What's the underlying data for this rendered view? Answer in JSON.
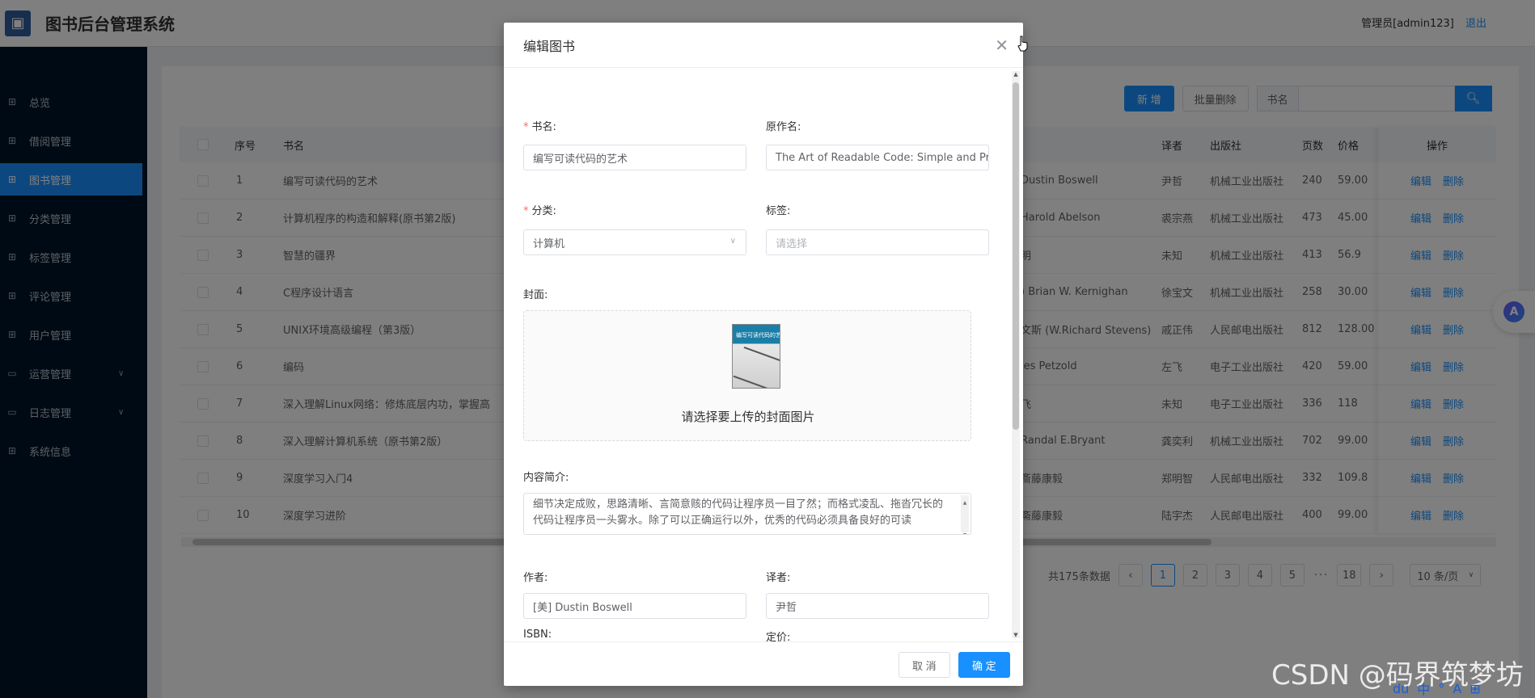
{
  "header": {
    "title": "图书后台管理系统",
    "user": "管理员[admin123]",
    "logout": "退出"
  },
  "sidebar": {
    "items": [
      {
        "label": "总览",
        "icon": "grid-icon"
      },
      {
        "label": "借阅管理",
        "icon": "grid-icon"
      },
      {
        "label": "图书管理",
        "icon": "grid-icon",
        "active": true
      },
      {
        "label": "分类管理",
        "icon": "grid-icon"
      },
      {
        "label": "标签管理",
        "icon": "grid-icon"
      },
      {
        "label": "评论管理",
        "icon": "grid-icon"
      },
      {
        "label": "用户管理",
        "icon": "grid-icon"
      },
      {
        "label": "运营管理",
        "icon": "folder-icon",
        "expandable": true
      },
      {
        "label": "日志管理",
        "icon": "folder-icon",
        "expandable": true
      },
      {
        "label": "系统信息",
        "icon": "grid-icon"
      }
    ]
  },
  "toolbar": {
    "add": "新 增",
    "batch_delete": "批量删除",
    "search_label": "书名"
  },
  "table": {
    "headers": {
      "index": "序号",
      "name": "书名",
      "translator": "译者",
      "publisher": "出版社",
      "pages": "页数",
      "price": "价格",
      "actions": "操作"
    },
    "edit": "编辑",
    "delete": "删除",
    "rows": [
      {
        "index": "1",
        "name": "编写可读代码的艺术",
        "author": "Dustin Boswell",
        "translator": "尹哲",
        "publisher": "机械工业出版社",
        "pages": "240",
        "price": "59.00"
      },
      {
        "index": "2",
        "name": "计算机程序的构造和解释(原书第2版)",
        "author": "Harold Abelson",
        "translator": "裘宗燕",
        "publisher": "机械工业出版社",
        "pages": "473",
        "price": "45.00"
      },
      {
        "index": "3",
        "name": "智慧的疆界",
        "author": "明",
        "translator": "未知",
        "publisher": "机械工业出版社",
        "pages": "413",
        "price": "56.9"
      },
      {
        "index": "4",
        "name": "C程序设计语言",
        "author": ") Brian W. Kernighan",
        "translator": "徐宝文",
        "publisher": "机械工业出版社",
        "pages": "258",
        "price": "30.00"
      },
      {
        "index": "5",
        "name": "UNIX环境高级编程（第3版）",
        "author": "文斯 (W.Richard Stevens)",
        "translator": "戚正伟",
        "publisher": "人民邮电出版社",
        "pages": "812",
        "price": "128.00"
      },
      {
        "index": "6",
        "name": "编码",
        "author": "les Petzold",
        "translator": "左飞",
        "publisher": "电子工业出版社",
        "pages": "420",
        "price": "59.00"
      },
      {
        "index": "7",
        "name": "深入理解Linux网络：修炼底层内功，掌握高",
        "author": "飞",
        "translator": "未知",
        "publisher": "电子工业出版社",
        "pages": "336",
        "price": "118"
      },
      {
        "index": "8",
        "name": "深入理解计算机系统（原书第2版）",
        "author": "Randal E.Bryant",
        "translator": "龚奕利",
        "publisher": "机械工业出版社",
        "pages": "702",
        "price": "99.00"
      },
      {
        "index": "9",
        "name": "深度学习入门4",
        "author": "斎藤康毅",
        "translator": "郑明智",
        "publisher": "人民邮电出版社",
        "pages": "332",
        "price": "109.8"
      },
      {
        "index": "10",
        "name": "深度学习进阶",
        "author": "斋藤康毅",
        "translator": "陆宇杰",
        "publisher": "人民邮电出版社",
        "pages": "400",
        "price": "99.00"
      }
    ]
  },
  "pager": {
    "total": "共175条数据",
    "pages": [
      "1",
      "2",
      "3",
      "4",
      "5"
    ],
    "dots": "···",
    "last": "18",
    "page_size": "10 条/页",
    "current": "1"
  },
  "dialog": {
    "title": "编辑图书",
    "fields": {
      "name_label": "书名:",
      "name_value": "编写可读代码的艺术",
      "orig_label": "原作名:",
      "orig_value": "The Art of Readable Code: Simple and Pr",
      "category_label": "分类:",
      "category_value": "计算机",
      "tags_label": "标签:",
      "tags_placeholder": "请选择",
      "cover_label": "封面:",
      "cover_hint": "请选择要上传的封面图片",
      "cover_title": "编写可读代码的艺术",
      "intro_label": "内容简介:",
      "intro_value": "细节决定成败，思路清晰、言简意赅的代码让程序员一目了然；而格式凌乱、拖沓冗长的代码让程序员一头雾水。除了可以正确运行以外，优秀的代码必须具备良好的可读",
      "author_label": "作者:",
      "author_value": "[美] Dustin Boswell",
      "translator_label": "译者:",
      "translator_value": "尹哲",
      "isbn_label": "ISBN:",
      "price_label": "定价:"
    },
    "cancel": "取 消",
    "confirm": "确 定"
  },
  "watermark": "CSDN @码界筑梦坊",
  "tray": {
    "items": [
      "du",
      "中",
      "°",
      "A",
      "⊞"
    ]
  }
}
